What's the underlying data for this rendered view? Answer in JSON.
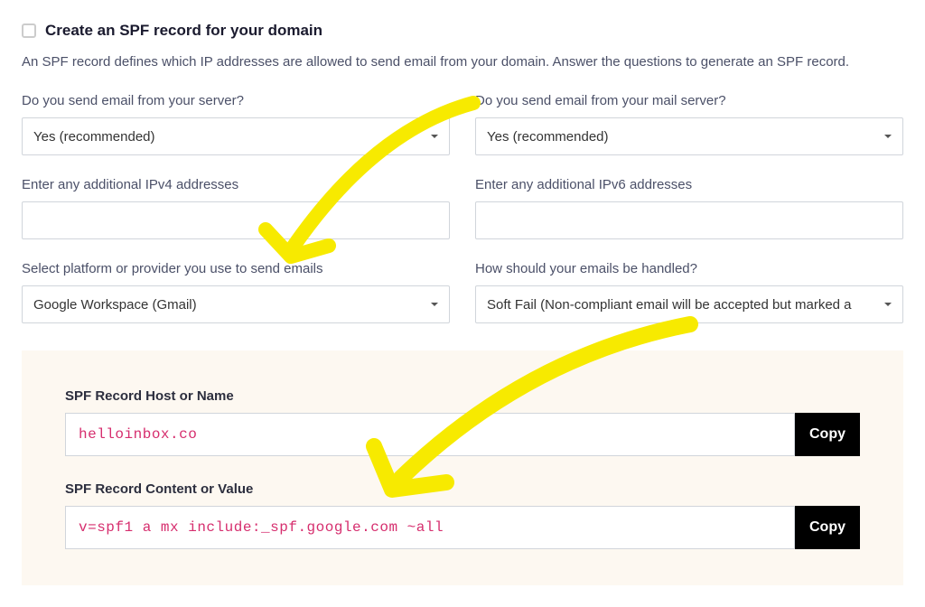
{
  "title": "Create an SPF record for your domain",
  "description": "An SPF record defines which IP addresses are allowed to send email from your domain. Answer the questions to generate an SPF record.",
  "fields": {
    "send_from_server": {
      "label": "Do you send email from your server?",
      "value": "Yes (recommended)"
    },
    "send_from_mail_server": {
      "label": "Do you send email from your mail server?",
      "value": "Yes (recommended)"
    },
    "ipv4": {
      "label": "Enter any additional IPv4 addresses",
      "value": ""
    },
    "ipv6": {
      "label": "Enter any additional IPv6 addresses",
      "value": ""
    },
    "platform": {
      "label": "Select platform or provider you use to send emails",
      "value": "Google Workspace (Gmail)"
    },
    "handling": {
      "label": "How should your emails be handled?",
      "value": "Soft Fail (Non-compliant email will be accepted but marked a"
    }
  },
  "output": {
    "host": {
      "label": "SPF Record Host or Name",
      "value": "helloinbox.co",
      "button": "Copy"
    },
    "content": {
      "label": "SPF Record Content or Value",
      "value": "v=spf1 a mx include:_spf.google.com ~all",
      "button": "Copy"
    }
  },
  "annotation_color": "#f7ea00"
}
